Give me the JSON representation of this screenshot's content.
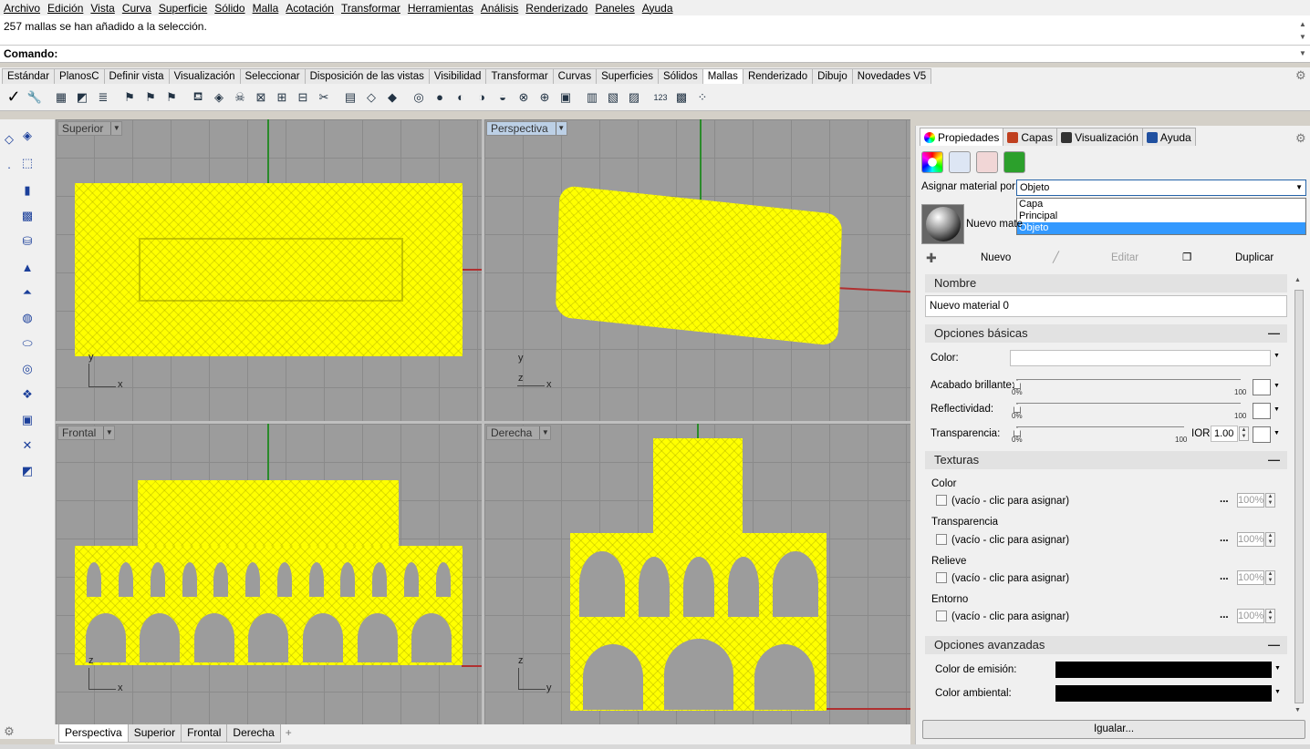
{
  "menu": [
    "Archivo",
    "Edición",
    "Vista",
    "Curva",
    "Superficie",
    "Sólido",
    "Malla",
    "Acotación",
    "Transformar",
    "Herramientas",
    "Análisis",
    "Renderizado",
    "Paneles",
    "Ayuda"
  ],
  "command": {
    "history": "257 mallas se han añadido a la selección.",
    "prompt": "Comando:"
  },
  "toolbar_tabs": [
    "Estándar",
    "PlanosC",
    "Definir vista",
    "Visualización",
    "Seleccionar",
    "Disposición de las vistas",
    "Visibilidad",
    "Transformar",
    "Curvas",
    "Superficies",
    "Sólidos",
    "Mallas",
    "Renderizado",
    "Dibujo",
    "Novedades V5"
  ],
  "active_toolbar_tab": "Mallas",
  "viewports": {
    "top_left": {
      "label": "Superior",
      "axis1": "y",
      "axis2": "x"
    },
    "top_right": {
      "label": "Perspectiva",
      "axis1": "y",
      "axis2": "x",
      "axis3": "z"
    },
    "bottom_left": {
      "label": "Frontal",
      "axis1": "z",
      "axis2": "x"
    },
    "bottom_right": {
      "label": "Derecha",
      "axis1": "z",
      "axis2": "y"
    }
  },
  "viewport_tabs": [
    "Perspectiva",
    "Superior",
    "Frontal",
    "Derecha",
    "+"
  ],
  "panel": {
    "tabs": [
      "Propiedades",
      "Capas",
      "Visualización",
      "Ayuda"
    ],
    "assign_label": "Asignar material por:",
    "assign_value": "Objeto",
    "dropdown_options": [
      "Capa",
      "Principal",
      "Objeto"
    ],
    "material_preview_name": "Nuevo mate",
    "actions": {
      "new": "Nuevo",
      "edit": "Editar",
      "duplicate": "Duplicar"
    },
    "name_section": "Nombre",
    "name_value": "Nuevo material 0",
    "basic_section": "Opciones básicas",
    "color_label": "Color:",
    "gloss_label": "Acabado brillante:",
    "reflect_label": "Reflectividad:",
    "transp_label": "Transparencia:",
    "ior_label": "IOR:",
    "ior_value": "1.00",
    "slider_min": "0%",
    "slider_max": "100",
    "textures_section": "Texturas",
    "texture_rows": [
      {
        "title": "Color",
        "slot": "(vacío - clic para asignar)",
        "amount": "100%"
      },
      {
        "title": "Transparencia",
        "slot": "(vacío - clic para asignar)",
        "amount": "100%"
      },
      {
        "title": "Relieve",
        "slot": "(vacío - clic para asignar)",
        "amount": "100%"
      },
      {
        "title": "Entorno",
        "slot": "(vacío - clic para asignar)",
        "amount": "100%"
      }
    ],
    "dots": "...",
    "advanced_section": "Opciones avanzadas",
    "emission_label": "Color de emisión:",
    "ambient_label": "Color ambiental:",
    "match_button": "Igualar..."
  },
  "colors": {
    "mesh": "#ffff00",
    "viewport_bg": "#9c9c9c",
    "selected": "#3399ff"
  }
}
